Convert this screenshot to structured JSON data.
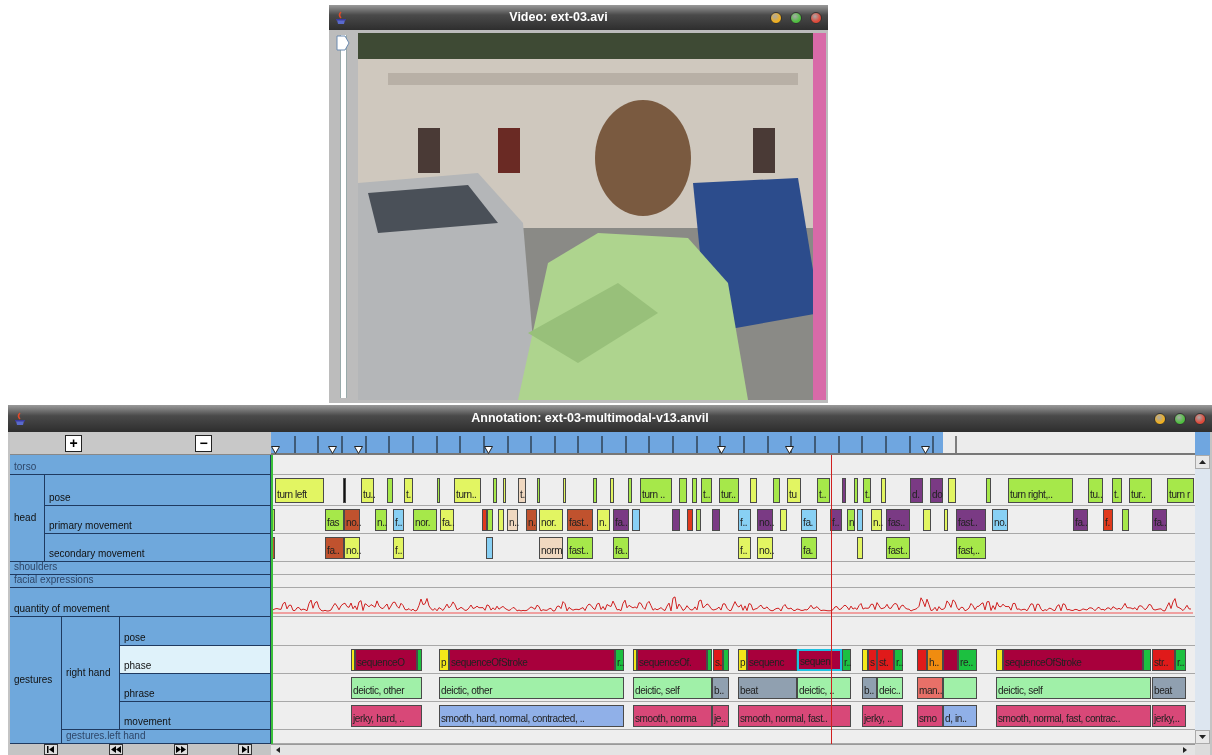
{
  "video_window": {
    "title": "Video: ext-03.avi",
    "slider": {
      "level": 1
    }
  },
  "annotation_window": {
    "title": "Annotation: ext-03-multimodal-v13.anvil",
    "zoom_in": "+",
    "zoom_out": "−",
    "tracks": [
      {
        "name": "torso",
        "kind": "annotation",
        "disabled": true,
        "selected": false
      },
      {
        "name": "head",
        "kind": "group",
        "children": [
          {
            "name": "pose",
            "kind": "annotation",
            "disabled": false,
            "selected": false,
            "elements": [
              {
                "label": "turn left",
                "color": "#e2f562",
                "selected": false
              },
              {
                "color": "#111111",
                "selected": false
              },
              {
                "label": "tu..",
                "color": "#e2f562",
                "selected": false
              },
              {
                "color": "#a6e84a",
                "selected": false
              },
              {
                "label": "t.",
                "color": "#e2f562",
                "selected": false
              },
              {
                "color": "#a6e84a",
                "selected": false
              },
              {
                "label": "turn..",
                "color": "#e2f562",
                "selected": false
              },
              {
                "color": "#a6e84a",
                "selected": false
              },
              {
                "color": "#e2f562",
                "selected": false
              },
              {
                "label": "t.",
                "color": "#f0d8c0",
                "selected": false
              },
              {
                "color": "#a6e84a",
                "selected": false
              },
              {
                "color": "#e2f562",
                "selected": false
              },
              {
                "color": "#a6e84a",
                "selected": false
              },
              {
                "color": "#e2f562",
                "selected": false
              },
              {
                "color": "#a6e84a",
                "selected": false
              },
              {
                "label": "turn ..",
                "color": "#a6e84a",
                "selected": false
              },
              {
                "color": "#a6e84a",
                "selected": false
              },
              {
                "color": "#a6e84a",
                "selected": false
              },
              {
                "label": "t..",
                "color": "#a6e84a",
                "selected": false
              },
              {
                "label": "tur..",
                "color": "#a6e84a",
                "selected": false
              },
              {
                "color": "#e2f562",
                "selected": false
              },
              {
                "color": "#a6e84a",
                "selected": false
              },
              {
                "label": "tu",
                "color": "#e2f562",
                "selected": false
              },
              {
                "label": "t..",
                "color": "#a6e84a",
                "selected": false
              },
              {
                "color": "#7a3a84",
                "selected": false
              },
              {
                "color": "#a6e84a",
                "selected": false
              },
              {
                "label": "t.",
                "color": "#a6e84a",
                "selected": false
              },
              {
                "color": "#e2f562",
                "selected": false
              },
              {
                "label": "d.",
                "color": "#7a3a84",
                "selected": false
              },
              {
                "label": "do",
                "color": "#7a3a84",
                "selected": false
              },
              {
                "color": "#e2f562",
                "selected": false
              },
              {
                "color": "#a6e84a",
                "selected": false
              },
              {
                "label": "turn right,..",
                "color": "#a6e84a",
                "selected": false
              },
              {
                "label": "tu..",
                "color": "#a6e84a",
                "selected": false
              },
              {
                "label": "t.",
                "color": "#a6e84a",
                "selected": false
              },
              {
                "label": "tur..",
                "color": "#a6e84a",
                "selected": false
              },
              {
                "label": "turn r",
                "color": "#a6e84a",
                "selected": false
              }
            ]
          },
          {
            "name": "primary movement",
            "kind": "annotation",
            "disabled": false,
            "selected": false,
            "elements": [
              {
                "color": "#a6e84a",
                "selected": false
              },
              {
                "label": "fas",
                "color": "#a6e84a",
                "selected": false
              },
              {
                "label": "no..",
                "color": "#c0522e",
                "selected": false
              },
              {
                "label": "n..",
                "color": "#a6e84a",
                "selected": false
              },
              {
                "label": "f..",
                "color": "#88d0f4",
                "selected": false
              },
              {
                "label": "nor.",
                "color": "#a6e84a",
                "selected": false
              },
              {
                "label": "fa..",
                "color": "#e2f562",
                "selected": false
              },
              {
                "color": "#e03a1c",
                "selected": false
              },
              {
                "color": "#a6e84a",
                "selected": false
              },
              {
                "color": "#e2f562",
                "selected": false
              },
              {
                "label": "n..",
                "color": "#f0d8c0",
                "selected": false
              },
              {
                "label": "n.",
                "color": "#c0522e",
                "selected": false
              },
              {
                "label": "nor.",
                "color": "#e2f562",
                "selected": false
              },
              {
                "label": "fast..",
                "color": "#c0522e",
                "selected": false
              },
              {
                "label": "n.",
                "color": "#e2f562",
                "selected": false
              },
              {
                "label": "fa..",
                "color": "#7a3a84",
                "selected": false
              },
              {
                "color": "#88d0f4",
                "selected": false
              },
              {
                "color": "#7a3a84",
                "selected": false
              },
              {
                "color": "#e03a1c",
                "selected": false
              },
              {
                "color": "#a6e84a",
                "selected": false
              },
              {
                "color": "#7a3a84",
                "selected": false
              },
              {
                "label": "f..",
                "color": "#88d0f4",
                "selected": false
              },
              {
                "label": "no..",
                "color": "#7a3a84",
                "selected": false
              },
              {
                "color": "#e2f562",
                "selected": false
              },
              {
                "label": "fa.",
                "color": "#88d0f4",
                "selected": false
              },
              {
                "label": "f..",
                "color": "#7a3a84",
                "selected": false
              },
              {
                "label": "n",
                "color": "#a6e84a",
                "selected": false
              },
              {
                "color": "#88d0f4",
                "selected": false
              },
              {
                "label": "n..",
                "color": "#e2f562",
                "selected": false
              },
              {
                "label": "fas..",
                "color": "#7a3a84",
                "selected": false
              },
              {
                "color": "#e2f562",
                "selected": false
              },
              {
                "color": "#e2f562",
                "selected": false
              },
              {
                "label": "fast..",
                "color": "#7a3a84",
                "selected": false
              },
              {
                "label": "no.",
                "color": "#88d0f4",
                "selected": false
              },
              {
                "label": "fa..",
                "color": "#7a3a84",
                "selected": false
              },
              {
                "label": "f.",
                "color": "#e03a1c",
                "selected": false
              },
              {
                "color": "#a6e84a",
                "selected": false
              },
              {
                "label": "fa..",
                "color": "#7a3a84",
                "selected": false
              }
            ]
          },
          {
            "name": "secondary movement",
            "kind": "annotation",
            "disabled": false,
            "selected": false,
            "elements": [
              {
                "color": "#c0522e",
                "selected": false
              },
              {
                "label": "fa..",
                "color": "#c0522e",
                "selected": false
              },
              {
                "label": "no..",
                "color": "#e2f562",
                "selected": false
              },
              {
                "label": "f..",
                "color": "#e2f562",
                "selected": false
              },
              {
                "color": "#88d0f4",
                "selected": false
              },
              {
                "label": "norm",
                "color": "#f0d8c0",
                "selected": false
              },
              {
                "label": "fast..",
                "color": "#a6e84a",
                "selected": false
              },
              {
                "label": "fa..",
                "color": "#a6e84a",
                "selected": false
              },
              {
                "label": "f..",
                "color": "#e2f562",
                "selected": false
              },
              {
                "label": "no..",
                "color": "#e2f562",
                "selected": false
              },
              {
                "label": "fa.",
                "color": "#a6e84a",
                "selected": false
              },
              {
                "color": "#e2f562",
                "selected": false
              },
              {
                "label": "fast..",
                "color": "#a6e84a",
                "selected": false
              },
              {
                "label": "fast,..",
                "color": "#a6e84a",
                "selected": false
              }
            ]
          }
        ]
      },
      {
        "name": "shoulders",
        "kind": "annotation",
        "disabled": true,
        "selected": false
      },
      {
        "name": "facial expressions",
        "kind": "annotation",
        "disabled": true,
        "selected": false
      },
      {
        "name": "quantity of movement",
        "kind": "graph",
        "disabled": false,
        "selected": false
      },
      {
        "name": "gestures",
        "kind": "group",
        "children": [
          {
            "name": "right hand",
            "kind": "group",
            "children": [
              {
                "name": "pose",
                "kind": "annotation",
                "disabled": false,
                "selected": false
              },
              {
                "name": "phase",
                "kind": "annotation",
                "disabled": false,
                "selected": true,
                "elements": [
                  {
                    "color": "#f4e81a",
                    "selected": false
                  },
                  {
                    "label": "sequenceO",
                    "color": "#a8003c",
                    "selected": false
                  },
                  {
                    "color": "#1cc040",
                    "selected": false
                  },
                  {
                    "label": "p",
                    "color": "#f4e81a",
                    "selected": false
                  },
                  {
                    "label": "sequenceOfStroke",
                    "color": "#a8003c",
                    "selected": false
                  },
                  {
                    "label": "r..",
                    "color": "#1cc040",
                    "selected": false
                  },
                  {
                    "color": "#f4e81a",
                    "selected": false
                  },
                  {
                    "label": "sequenceOf.",
                    "color": "#a8003c",
                    "selected": false
                  },
                  {
                    "color": "#1cc040",
                    "selected": false
                  },
                  {
                    "label": "s.",
                    "color": "#e01a1a",
                    "selected": false
                  },
                  {
                    "color": "#1cc040",
                    "selected": false
                  },
                  {
                    "label": "p",
                    "color": "#f4e81a",
                    "selected": false
                  },
                  {
                    "label": "sequenc",
                    "color": "#a8003c",
                    "selected": false
                  },
                  {
                    "label": "sequen",
                    "color": "#a8003c",
                    "selected": true
                  },
                  {
                    "label": "r..",
                    "color": "#1cc040",
                    "selected": false
                  },
                  {
                    "color": "#f4e81a",
                    "selected": false
                  },
                  {
                    "label": "s",
                    "color": "#e01a1a",
                    "selected": false
                  },
                  {
                    "label": "st.",
                    "color": "#e01a1a",
                    "selected": false
                  },
                  {
                    "label": "r..",
                    "color": "#1cc040",
                    "selected": false
                  },
                  {
                    "color": "#e01a1a",
                    "selected": false
                  },
                  {
                    "label": "h..",
                    "color": "#f08c10",
                    "selected": false
                  },
                  {
                    "color": "#a8003c",
                    "selected": false
                  },
                  {
                    "label": "re..",
                    "color": "#1cc040",
                    "selected": false
                  },
                  {
                    "color": "#f4e81a",
                    "selected": false
                  },
                  {
                    "label": "sequenceOfStroke",
                    "color": "#a8003c",
                    "selected": false
                  },
                  {
                    "color": "#1cc040",
                    "selected": false
                  },
                  {
                    "label": "str..",
                    "color": "#e01a1a",
                    "selected": false
                  },
                  {
                    "label": "r..",
                    "color": "#1cc040",
                    "selected": false
                  }
                ]
              },
              {
                "name": "phrase",
                "kind": "annotation",
                "disabled": false,
                "selected": false,
                "elements": [
                  {
                    "label": "deictic, other",
                    "color": "#a0f0a8",
                    "selected": false
                  },
                  {
                    "label": "deictic, other",
                    "color": "#a0f0a8",
                    "selected": false
                  },
                  {
                    "label": "deictic, self",
                    "color": "#a0f0a8",
                    "selected": false
                  },
                  {
                    "label": "b..",
                    "color": "#90a0b0",
                    "selected": false
                  },
                  {
                    "label": "beat",
                    "color": "#90a0b0",
                    "selected": false
                  },
                  {
                    "label": "deictic, ..",
                    "color": "#a0f0a8",
                    "selected": false
                  },
                  {
                    "label": "b..",
                    "color": "#90a0b0",
                    "selected": false
                  },
                  {
                    "label": "deic..",
                    "color": "#a0f0a8",
                    "selected": false
                  },
                  {
                    "label": "man..",
                    "color": "#e87068",
                    "selected": false
                  },
                  {
                    "color": "#a0f0a8",
                    "selected": false
                  },
                  {
                    "label": "deictic, self",
                    "color": "#a0f0a8",
                    "selected": false
                  },
                  {
                    "label": "beat",
                    "color": "#90a0b0",
                    "selected": false
                  }
                ]
              },
              {
                "name": "movement",
                "kind": "annotation",
                "disabled": false,
                "selected": false,
                "elements": [
                  {
                    "label": "jerky, hard, ..",
                    "color": "#d84878",
                    "selected": false
                  },
                  {
                    "label": "smooth, hard, normal, contracted, ..",
                    "color": "#90b0e8",
                    "selected": false
                  },
                  {
                    "label": "smooth, norma",
                    "color": "#d84878",
                    "selected": false
                  },
                  {
                    "label": "je..",
                    "color": "#d84878",
                    "selected": false
                  },
                  {
                    "label": "smooth, normal, fast..",
                    "color": "#d84878",
                    "selected": false
                  },
                  {
                    "label": "jerky, ..",
                    "color": "#d84878",
                    "selected": false
                  },
                  {
                    "label": "smo",
                    "color": "#d84878",
                    "selected": false
                  },
                  {
                    "label": "d, in..",
                    "color": "#90b0e8",
                    "selected": false
                  },
                  {
                    "label": "smooth, normal, fast, contrac..",
                    "color": "#d84878",
                    "selected": false
                  },
                  {
                    "label": "jerky,..",
                    "color": "#d84878",
                    "selected": false
                  }
                ]
              }
            ]
          },
          {
            "name": "gestures.left hand",
            "kind": "annotation",
            "disabled": true,
            "selected": false
          }
        ]
      }
    ]
  }
}
